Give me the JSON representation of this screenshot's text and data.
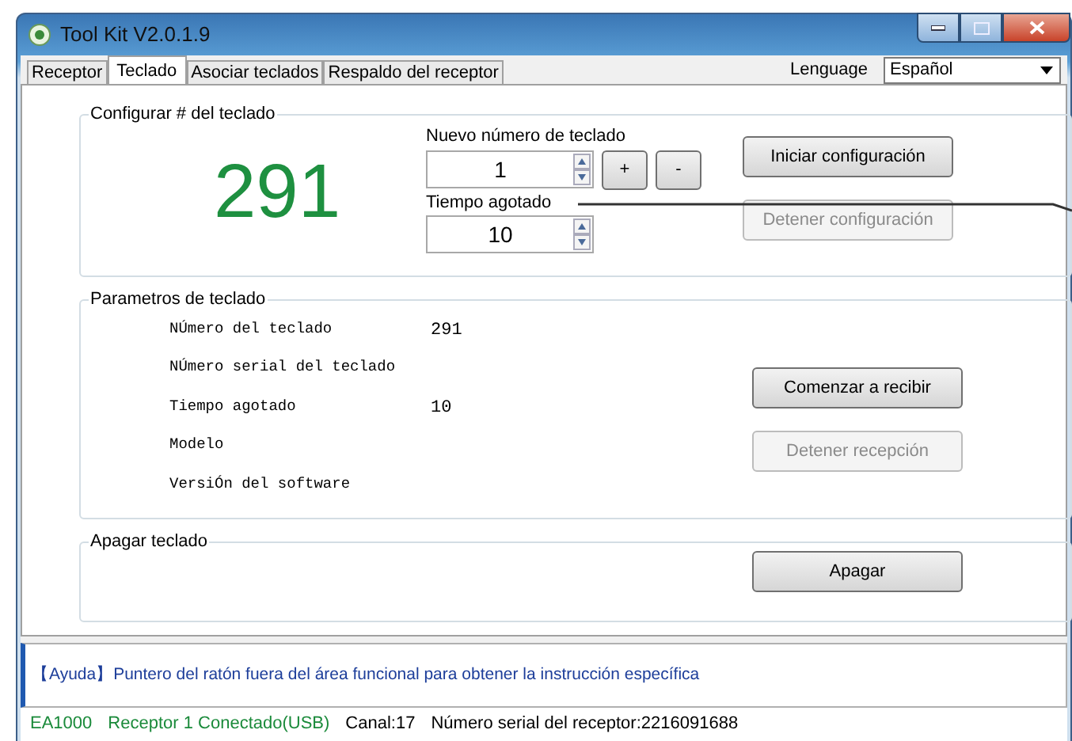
{
  "window": {
    "title": "Tool Kit  V2.0.1.9"
  },
  "tabs": [
    {
      "label": "Receptor",
      "selected": false
    },
    {
      "label": "Teclado",
      "selected": true
    },
    {
      "label": "Asociar teclados",
      "selected": false
    },
    {
      "label": "Respaldo del receptor",
      "selected": false
    }
  ],
  "language": {
    "label": "Lenguage",
    "value": "Español"
  },
  "configure_group": {
    "title": "Configurar # del teclado",
    "current_number": "291",
    "fields": [
      {
        "label": "Nuevo número de teclado",
        "value": "1"
      },
      {
        "label": "Tiempo agotado",
        "value": "10"
      }
    ],
    "step_buttons": [
      "+",
      "-"
    ],
    "buttons": [
      {
        "label": "Iniciar configuración",
        "disabled": false
      },
      {
        "label": "Detener configuración",
        "disabled": true
      }
    ]
  },
  "params_group": {
    "title": "Parametros de teclado",
    "rows": [
      {
        "label": "NÚmero del teclado",
        "value": "291"
      },
      {
        "label": "NÚmero serial del teclado"
      },
      {
        "label": "Tiempo agotado",
        "value": "10"
      },
      {
        "label": "Modelo"
      },
      {
        "label": "VersiÓn del software"
      }
    ],
    "buttons": [
      {
        "label": "Comenzar a recibir",
        "disabled": false
      },
      {
        "label": "Detener recepción",
        "disabled": true
      }
    ]
  },
  "shutdown_group": {
    "title": "Apagar teclado",
    "button": {
      "label": "Apagar",
      "disabled": false
    }
  },
  "help": {
    "text": "【Ayuda】Puntero del ratón fuera del área funcional para obtener la instrucción específica"
  },
  "status_bar": [
    {
      "text": "EA1000",
      "color": "#1a8a3a"
    },
    {
      "text": "Receptor 1 Conectado(USB)",
      "color": "#1a8a3a"
    },
    {
      "text": "Canal:17",
      "color": "#000000"
    },
    {
      "text": "Número serial del receptor:2216091688",
      "color": "#000000"
    }
  ]
}
